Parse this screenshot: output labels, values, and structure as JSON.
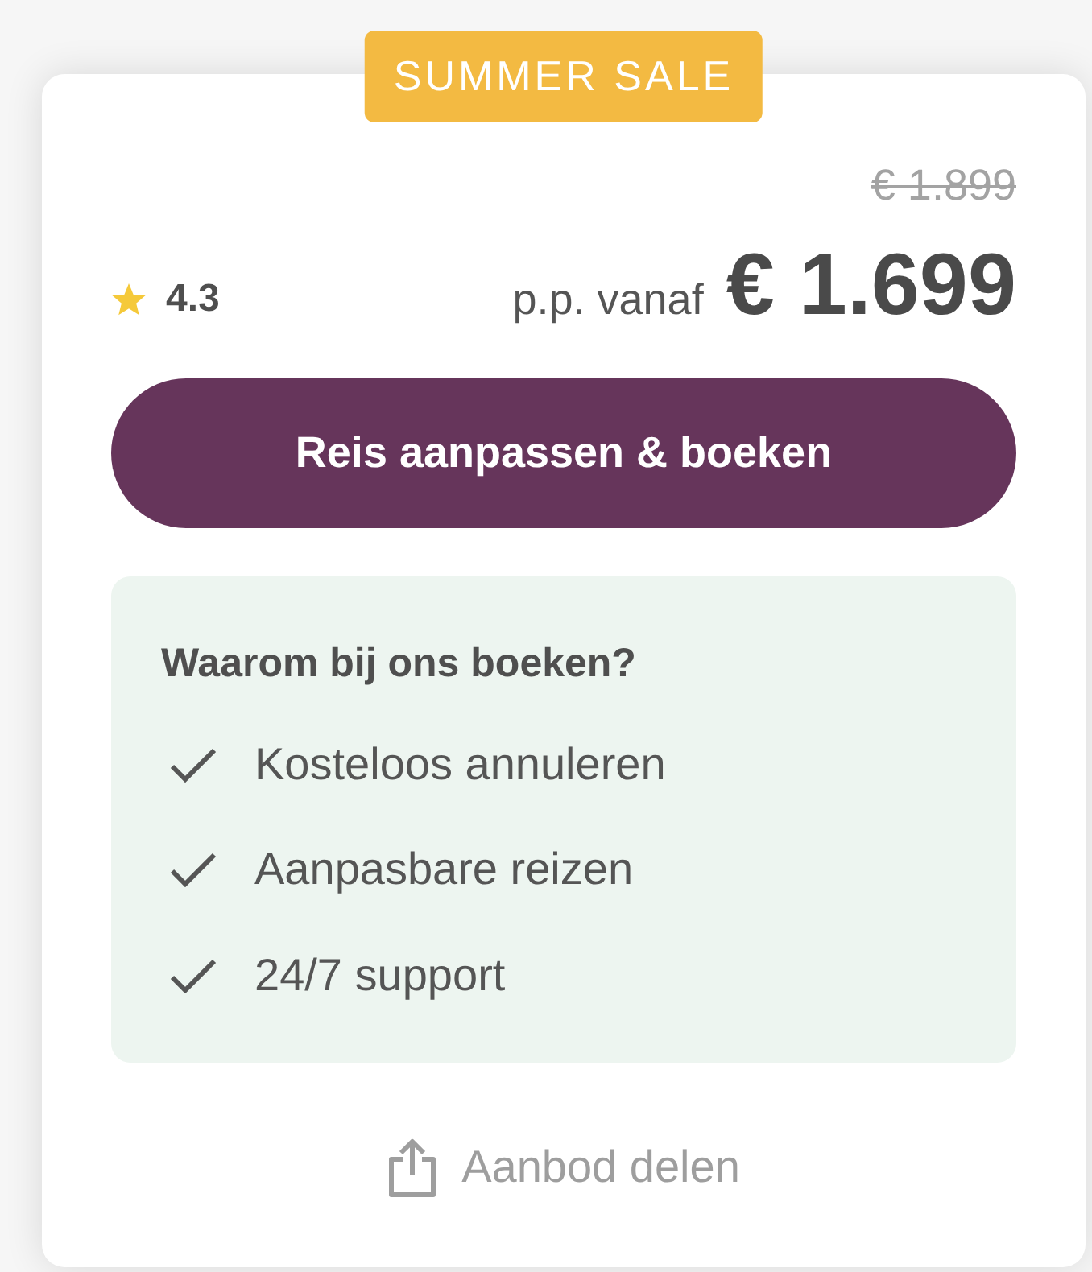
{
  "badge": {
    "label": "SUMMER SALE"
  },
  "pricing": {
    "old_price": "€ 1.899",
    "rating": "4.3",
    "prefix": "p.p. vanaf",
    "price": "€ 1.699"
  },
  "cta": {
    "label": "Reis aanpassen & boeken"
  },
  "benefits": {
    "title": "Waarom bij ons boeken?",
    "items": [
      {
        "label": "Kosteloos annuleren"
      },
      {
        "label": "Aanpasbare reizen"
      },
      {
        "label": "24/7 support"
      }
    ]
  },
  "share": {
    "label": "Aanbod delen"
  }
}
